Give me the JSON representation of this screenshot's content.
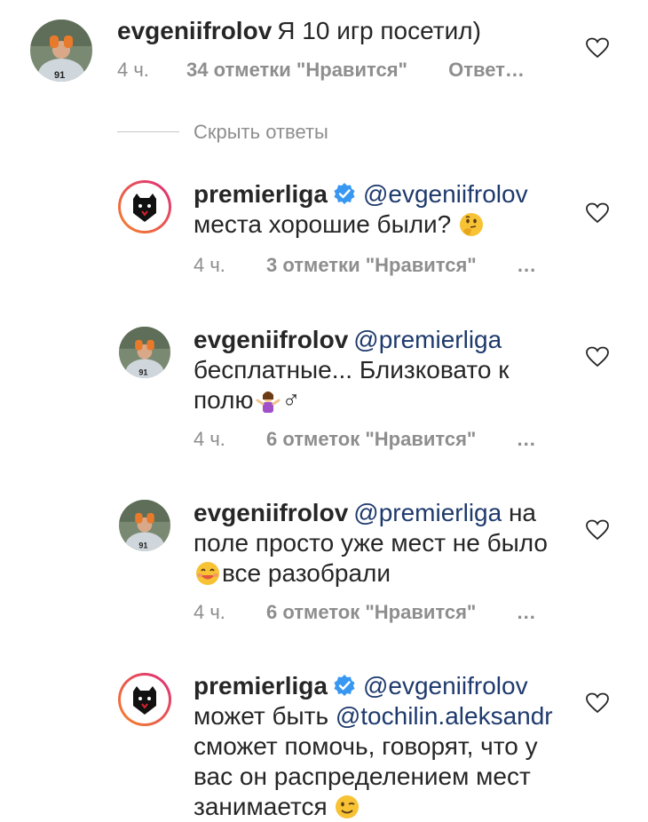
{
  "comments": [
    {
      "username": "evgeniifrolov",
      "mention": "",
      "text": "Я 10 игр посетил)",
      "time": "4 ч.",
      "likes": "34 отметки \"Нравится\"",
      "reply": "Ответ…",
      "more": ""
    },
    {
      "username": "premierliga",
      "mention": "@evgeniifrolov",
      "text": "места хорошие были?",
      "time": "4 ч.",
      "likes": "3 отметки \"Нравится\"",
      "reply": "",
      "more": "..."
    },
    {
      "username": "evgeniifrolov",
      "mention": "@premierliga",
      "text": "бесплатные... Близковато к полю",
      "text_tail": "♂",
      "time": "4 ч.",
      "likes": "6 отметок \"Нравится\"",
      "reply": "",
      "more": "..."
    },
    {
      "username": "evgeniifrolov",
      "mention": "@premierliga",
      "text_pre": "на поле просто уже мест не было",
      "text": "все разобрали",
      "time": "4 ч.",
      "likes": "6 отметок \"Нравится\"",
      "reply": "",
      "more": "..."
    },
    {
      "username": "premierliga",
      "mention": "@evgeniifrolov",
      "text_pre": "может быть",
      "mention2": "@tochilin.aleksandr",
      "text": "сможет помочь, говорят, что у вас он распределением мест занимается"
    }
  ],
  "thread": {
    "hide_replies": "Скрыть ответы"
  },
  "icons": {
    "heart": "heart-outline-icon",
    "verified": "verified-badge-icon"
  },
  "colors": {
    "text": "#262626",
    "meta": "#8e8e8e",
    "mention": "#1e3a6d",
    "verified": "#3897f0",
    "story_ring_start": "#f58529",
    "story_ring_end": "#dd2a7b"
  }
}
